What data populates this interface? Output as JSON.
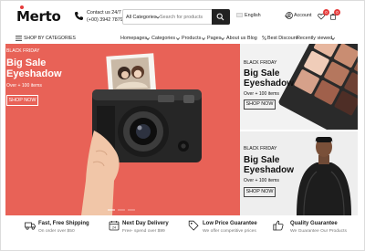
{
  "header": {
    "logo": "Merto",
    "contact_line1": "Contact us 24/7",
    "contact_line2": "(+00) 3942 7879",
    "search_category": "All Categories",
    "search_placeholder": "Search for products",
    "language": "English",
    "account": "Account",
    "wishlist_count": "0",
    "cart_count": "0"
  },
  "nav": {
    "shop_by_categories": "SHOP BY CATEGORIES",
    "items": [
      "Homepages",
      "Categories",
      "Products",
      "Pages",
      "About us",
      "Blog",
      "Best Discount"
    ],
    "recently_viewed": "Recently viewed"
  },
  "hero": {
    "subtitle": "BLACK FRIDAY",
    "title": "Big Sale Eyeshadow",
    "meta": "Over + 100 items",
    "button": "SHOP NOW",
    "accent": "#e86257"
  },
  "promos": [
    {
      "subtitle": "BLACK FRIDAY",
      "title": "Big Sale Eyeshadow",
      "meta": "Over + 100 items",
      "button": "SHOP NOW"
    },
    {
      "subtitle": "BLACK FRIDAY",
      "title": "Big Sale Eyeshadow",
      "meta": "Over + 100 items",
      "button": "SHOP NOW"
    }
  ],
  "features": [
    {
      "icon": "truck-icon",
      "title": "Fast, Free Shipping",
      "desc": "On order over $50"
    },
    {
      "icon": "calendar-icon",
      "title": "Next Day Delivery",
      "desc": "Free- spend over $99"
    },
    {
      "icon": "price-tag-icon",
      "title": "Low Price Guarantee",
      "desc": "We offer competitive prices"
    },
    {
      "icon": "thumbs-up-icon",
      "title": "Quality Guarantee",
      "desc": "We Guarantee Our Products"
    }
  ]
}
